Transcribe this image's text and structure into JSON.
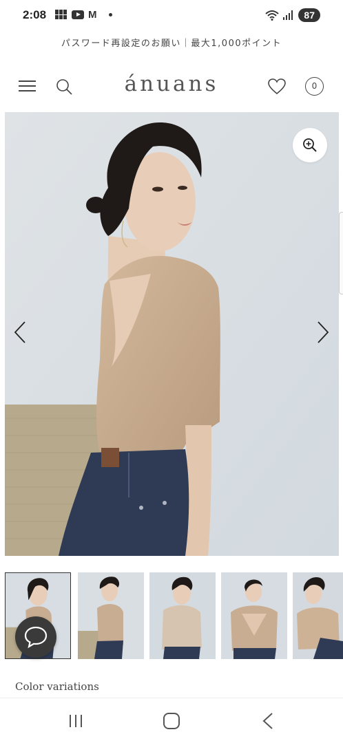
{
  "status_bar": {
    "time": "2:08",
    "battery": "87",
    "icons": [
      "grid-app-icon",
      "youtube-icon",
      "gmail-icon",
      "dot-icon",
      "wifi-icon",
      "signal-icon"
    ]
  },
  "announcement": "パスワード再設定のお願い｜最大1,000ポイント",
  "header": {
    "logo": "ánuans",
    "cart_count": "0",
    "icons": [
      "menu-icon",
      "search-icon",
      "heart-icon"
    ]
  },
  "gallery": {
    "image_count": 5,
    "active_index": 0,
    "colors": {
      "background": "#d9dfe4",
      "garment": "#c8ad92",
      "denim": "#2f3b55",
      "hair": "#1f1a17",
      "skin": "#e8cdb8",
      "wall_weave": "#b7a98c"
    }
  },
  "section": {
    "color_variations_heading": "Color variations"
  },
  "nav": {
    "icons": [
      "recent-apps-icon",
      "home-icon",
      "back-icon"
    ]
  }
}
